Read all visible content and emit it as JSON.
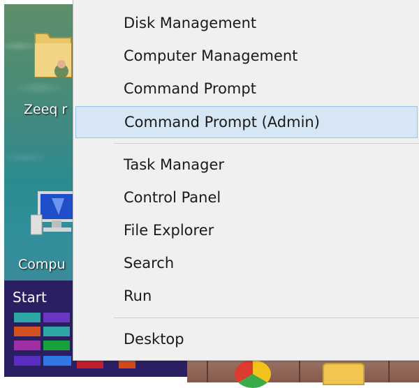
{
  "desktop": {
    "user_folder_label": "Zeeq r",
    "computer_label": "Compu"
  },
  "start": {
    "label": "Start",
    "tiles": [
      {
        "color": "#2fa6a6"
      },
      {
        "color": "#6a37c0"
      },
      {
        "color": "#d35020"
      },
      {
        "color": "#2fa6a6"
      },
      {
        "color": "#a02fa6"
      },
      {
        "color": "#17a23a"
      },
      {
        "color": "#5a2fc0"
      },
      {
        "color": "#2f78e6"
      },
      {
        "color": "#c01f2f"
      },
      {
        "color": "#d24a1a"
      }
    ]
  },
  "menu": {
    "groups": [
      {
        "items": [
          {
            "label": "Disk Management"
          },
          {
            "label": "Computer Management"
          },
          {
            "label": "Command Prompt"
          },
          {
            "label": "Command Prompt (Admin)",
            "highlighted": true
          }
        ]
      },
      {
        "items": [
          {
            "label": "Task Manager"
          },
          {
            "label": "Control Panel"
          },
          {
            "label": "File Explorer"
          },
          {
            "label": "Search"
          },
          {
            "label": "Run"
          }
        ]
      },
      {
        "items": [
          {
            "label": "Desktop"
          }
        ]
      }
    ]
  },
  "colors": {
    "menu_bg": "#f0f0f0",
    "highlight_bg": "#d7e6f5",
    "highlight_border": "#9cc2e6",
    "start_bg": "#2a1f63",
    "taskbar": "#9c7566"
  }
}
